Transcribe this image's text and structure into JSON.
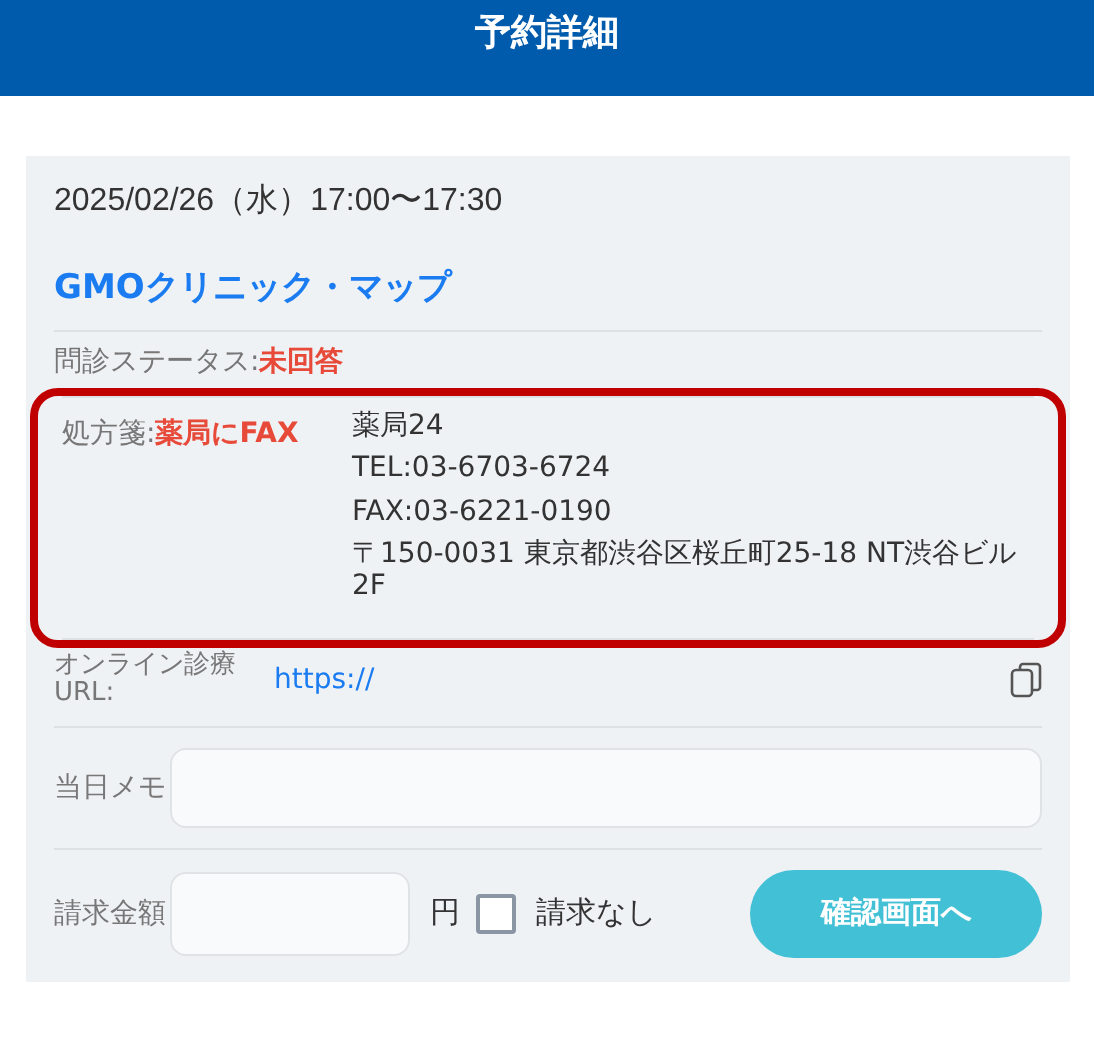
{
  "header": {
    "title": "予約詳細"
  },
  "appointment": {
    "datetime": "2025/02/26（水）17:00〜17:30",
    "clinic": "GMOクリニック・マップ"
  },
  "questionnaire": {
    "label": "問診ステータス:",
    "status": "未回答"
  },
  "prescription": {
    "highlighted": true,
    "label": "処方箋:",
    "method": "薬局にFAX",
    "lines": [
      "薬局24",
      "TEL:03-6703-6724",
      "FAX:03-6221-0190",
      "〒150-0031 東京都渋谷区桜丘町25-18 NT渋谷ビル2F"
    ]
  },
  "online": {
    "label": "オンライン診療URL:",
    "link": "https://"
  },
  "memo": {
    "label": "当日メモ"
  },
  "billing": {
    "label": "請求金額",
    "unit": "円",
    "no_charge": {
      "label": "請求なし",
      "checked": false
    },
    "button": "確認画面へ"
  }
}
